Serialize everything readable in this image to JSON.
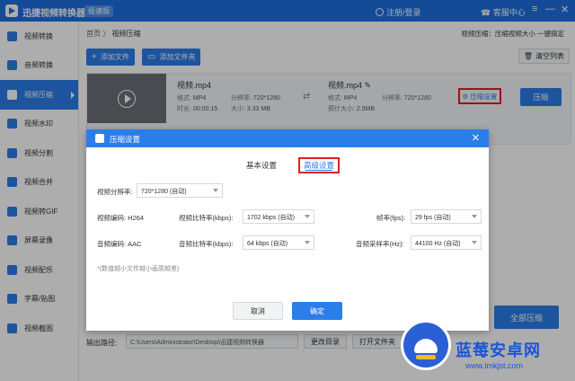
{
  "titlebar": {
    "app_title": "迅捷视频转换器",
    "edition": "极速版",
    "login": "注册/登录",
    "service": "客服中心",
    "menu_glyph": "≡",
    "min_glyph": "—",
    "close_glyph": "✕"
  },
  "sidebar": {
    "items": [
      {
        "label": "视频转换"
      },
      {
        "label": "音频转换"
      },
      {
        "label": "视频压缩"
      },
      {
        "label": "视频水印"
      },
      {
        "label": "视频分割"
      },
      {
        "label": "视频合并"
      },
      {
        "label": "视频转GIF"
      },
      {
        "label": "屏幕录像"
      },
      {
        "label": "视频配乐"
      },
      {
        "label": "字幕/贴图"
      },
      {
        "label": "视频截图"
      }
    ],
    "active_index": 2
  },
  "main": {
    "breadcrumb_home": "首页",
    "breadcrumb_sep": "〉",
    "breadcrumb_current": "视频压缩",
    "hint": "视频压缩：压缩视频大小 一键搞定",
    "add_file": "添加文件",
    "add_folder": "添加文件夹",
    "clear_list": "清空列表",
    "file": {
      "name": "视频.mp4",
      "format_label": "格式:",
      "format": "MP4",
      "resolution_label": "分辨率:",
      "resolution": "720*1280",
      "duration_label": "时长:",
      "duration": "00:00:15",
      "size_label": "大小:",
      "size": "3.33 MB",
      "out_name": "视频.mp4",
      "out_format_label": "格式:",
      "out_format": "MP4",
      "out_resolution_label": "分辨率:",
      "out_resolution": "720*1280",
      "est_size_label": "预计大小:",
      "est_size": "2.5MB",
      "settings_link": "压缩设置",
      "compress_btn": "压缩"
    },
    "compress_all": "全部压缩",
    "output_path_label": "输出路径:",
    "output_path": "C:\\Users\\Administrator\\Desktop\\迅捷视频转换器",
    "change_dir": "更改目录",
    "open_folder": "打开文件夹"
  },
  "dialog": {
    "title": "压缩设置",
    "tab_basic": "基本设置",
    "tab_advanced": "高级设置",
    "resolution_label": "视频分辨率:",
    "resolution_value": "720*1280 (自动)",
    "video_codec": "视频编码: H264",
    "video_bitrate_label": "视频比特率(kbps):",
    "video_bitrate_value": "1702 kbps (自动)",
    "fps_label": "帧率(fps):",
    "fps_value": "29 fps (自动)",
    "audio_codec": "音频编码: AAC",
    "audio_bitrate_label": "音频比特率(kbps):",
    "audio_bitrate_value": "64 kbps (自动)",
    "sample_rate_label": "音频采样率(Hz):",
    "sample_rate_value": "44100 Hz (自动)",
    "note": "*(数值越小文件越小画质越差)",
    "cancel": "取消",
    "ok": "确定"
  },
  "watermark": {
    "text": "蓝莓安卓网",
    "url": "www.lmkjst.com"
  },
  "colors": {
    "primary": "#2b7de9",
    "titlebar": "#1d6fe0",
    "highlight_box": "#e02020"
  }
}
